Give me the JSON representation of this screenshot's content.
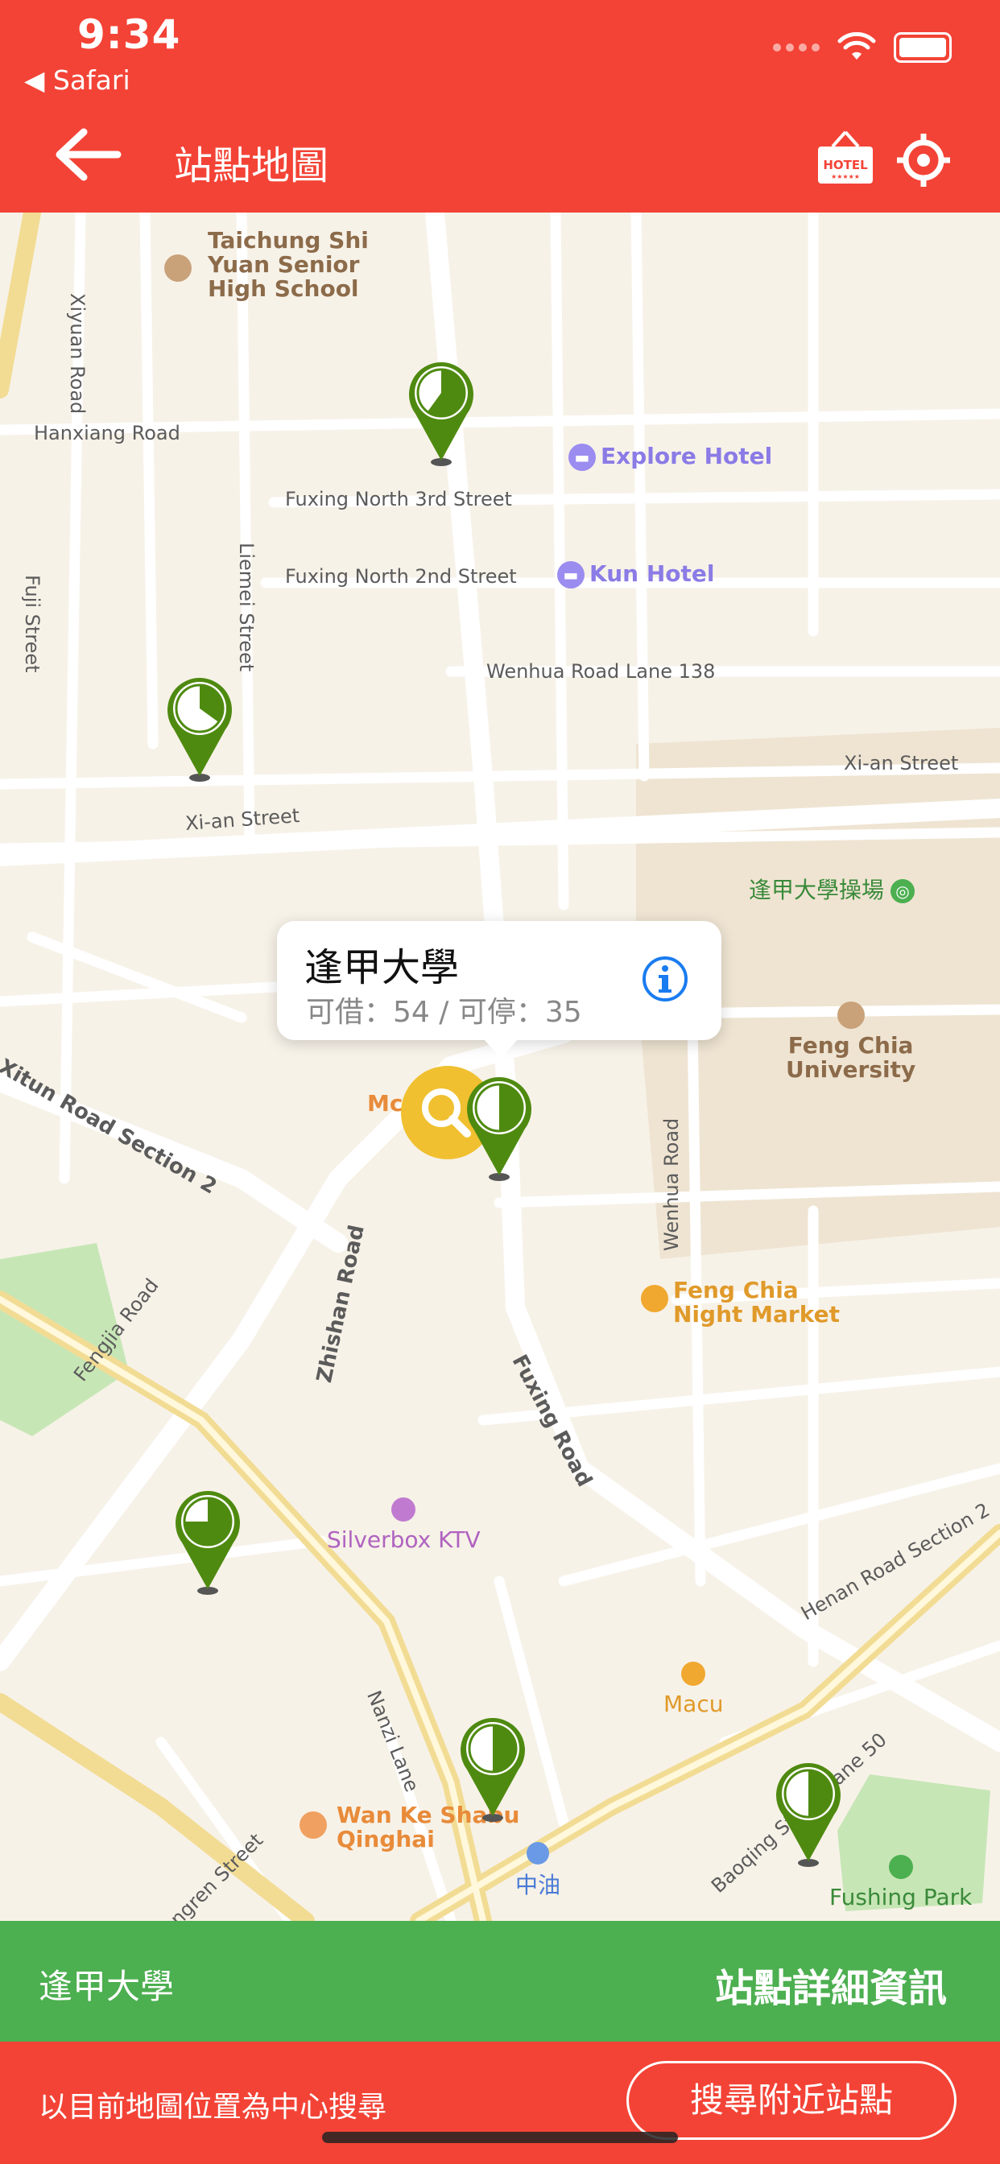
{
  "status": {
    "time": "9:34",
    "back_app": "◀ Safari"
  },
  "header": {
    "title": "站點地圖",
    "hotel_sign": "HOTEL"
  },
  "map_labels": {
    "school": "Taichung Shi\nYuan Senior\nHigh School",
    "xiyuan_road": "Xiyuan Road",
    "hanxiang_road": "Hanxiang Road",
    "explore_hotel": "Explore Hotel",
    "fuxing_north_3rd": "Fuxing North 3rd Street",
    "fuxing_north_2nd": "Fuxing North 2nd Street",
    "kun_hotel": "Kun Hotel",
    "fuji_street": "Fuji Street",
    "liemei_street": "Liemei Street",
    "wenhua_lane": "Wenhua Road Lane 138",
    "xian_street_left": "Xi-an Street",
    "xian_street_right": "Xi-an Street",
    "fcu_field": "逢甲大學操場",
    "feng_chia_university": "Feng Chia\nUniversity",
    "xitun_road": "Xitun Road Section 2",
    "mcd": "Mc",
    "wenhua_road": "Wenhua Road",
    "zhishan_road": "Zhishan Road",
    "fengjia_road": "Fengjia Road",
    "feng_chia_night_market": "Feng Chia\nNight Market",
    "fuxing_road": "Fuxing Road",
    "silverbox": "Silverbox KTV",
    "henan_road": "Henan Road Section 2",
    "macu": "Macu",
    "nanzi_lane": "Nanzi Lane",
    "wan_ke_shabu": "Wan Ke Shabu\nQinghai",
    "cpc": "中油",
    "baoqing": "Baoqing Street Lane 50",
    "fushing_park": "Fushing Park",
    "bottom_street": "ngren Street"
  },
  "stations": [
    {
      "name": "station-pin",
      "ratio": 0.6
    },
    {
      "name": "station-pin",
      "ratio": 0.35
    },
    {
      "name": "station-pin",
      "ratio": 0.5
    },
    {
      "name": "station-pin",
      "ratio": 0.75
    },
    {
      "name": "station-pin",
      "ratio": 0.5
    },
    {
      "name": "station-pin",
      "ratio": 0.5
    }
  ],
  "callout": {
    "name": "逢甲大學",
    "counts": "可借：54 / 可停：35"
  },
  "detail_bar": {
    "station_name": "逢甲大學",
    "detail_link": "站點詳細資訊"
  },
  "search_bar": {
    "hint": "以目前地圖位置為中心搜尋",
    "button": "搜尋附近站點"
  },
  "colors": {
    "header_red": "#f34336",
    "detail_green": "#4caf50",
    "pin_green": "#4f8a10"
  }
}
